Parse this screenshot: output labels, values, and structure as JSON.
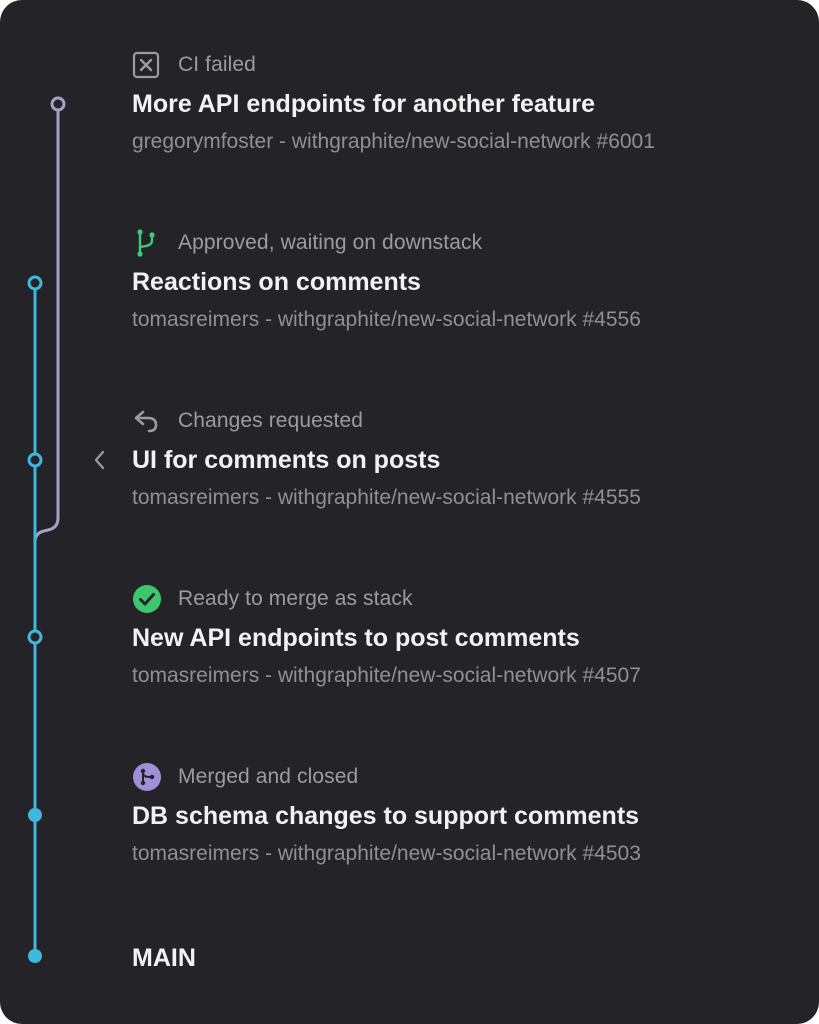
{
  "stack": [
    {
      "status": "CI failed",
      "status_icon": "ci-failed-icon",
      "title": "More API endpoints for another feature",
      "subtitle": "gregorymfoster - withgraphite/new-social-network #6001"
    },
    {
      "status": "Approved, waiting on downstack",
      "status_icon": "branch-icon",
      "title": "Reactions on comments",
      "subtitle": "tomasreimers - withgraphite/new-social-network #4556"
    },
    {
      "status": "Changes requested",
      "status_icon": "undo-arrow-icon",
      "title": "UI for comments on posts",
      "subtitle": "tomasreimers - withgraphite/new-social-network #4555"
    },
    {
      "status": "Ready to merge as stack",
      "status_icon": "check-circle-icon",
      "title": "New API endpoints to post comments",
      "subtitle": "tomasreimers - withgraphite/new-social-network #4507"
    },
    {
      "status": "Merged and closed",
      "status_icon": "merged-icon",
      "title": "DB schema changes to support comments",
      "subtitle": "tomasreimers - withgraphite/new-social-network #4503"
    }
  ],
  "main_label": "MAIN",
  "colors": {
    "background": "#242428",
    "stack_line": "#3fb8dc",
    "side_line": "#a6a1c4",
    "ci_failed": "#9b9ba2",
    "approved": "#3fc97a",
    "ready": "#3cc76e",
    "merged": "#9f8fd6"
  }
}
